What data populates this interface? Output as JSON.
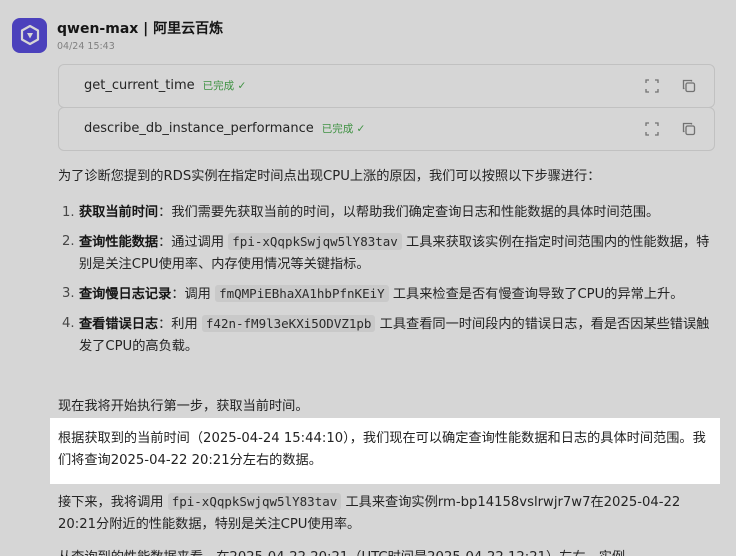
{
  "header": {
    "model_name": "qwen-max | 阿里云百炼",
    "timestamp": "04/24 15:43"
  },
  "tools": [
    {
      "name": "get_current_time",
      "status": "已完成 ✓"
    },
    {
      "name": "describe_db_instance_performance",
      "status": "已完成 ✓"
    }
  ],
  "intro": "为了诊断您提到的RDS实例在指定时间点出现CPU上涨的原因，我们可以按照以下步骤进行：",
  "steps": [
    {
      "num": "1.",
      "title": "获取当前时间",
      "sep": "：",
      "text": "我们需要先获取当前的时间，以帮助我们确定查询日志和性能数据的具体时间范围。"
    },
    {
      "num": "2.",
      "title": "查询性能数据",
      "sep": "：通过调用 ",
      "code": "fpi-xQqpkSwjqw5lY83tav",
      "text": " 工具来获取该实例在指定时间范围内的性能数据，特别是关注CPU使用率、内存使用情况等关键指标。"
    },
    {
      "num": "3.",
      "title": "查询慢日志记录",
      "sep": "：调用 ",
      "code": "fmQMPiEBhaXA1hbPfnKEiY",
      "text": " 工具来检查是否有慢查询导致了CPU的异常上升。"
    },
    {
      "num": "4.",
      "title": "查看错误日志",
      "sep": "：利用 ",
      "code": "f42n-fM9l3eKXi5ODVZ1pb",
      "text": " 工具查看同一时间段内的错误日志，看是否因某些错误触发了CPU的高负载。"
    }
  ],
  "step_now": "现在我将开始执行第一步，获取当前时间。",
  "highlight": "根据获取到的当前时间（2025-04-24 15:44:10），我们现在可以确定查询性能数据和日志的具体时间范围。我们将查询2025-04-22 20:21分左右的数据。",
  "next": {
    "before": "接下来，我将调用 ",
    "code": "fpi-xQqpkSwjqw5lY83tav",
    "after": " 工具来查询实例rm-bp14158vslrwjr7w7在2025-04-22 20:21分附近的性能数据，特别是关注CPU使用率。"
  },
  "cut_off": "从查询到的性能数据来看，在2025-04-22 20:21（UTC时间是2025-04-22 12:21）左右，实例",
  "icons": {
    "avatar": "qwen-logo-icon",
    "expand": "expand-icon",
    "copy": "copy-icon"
  },
  "colors": {
    "avatar_bg": "#5a4ee0",
    "status_green": "#4caf50"
  }
}
